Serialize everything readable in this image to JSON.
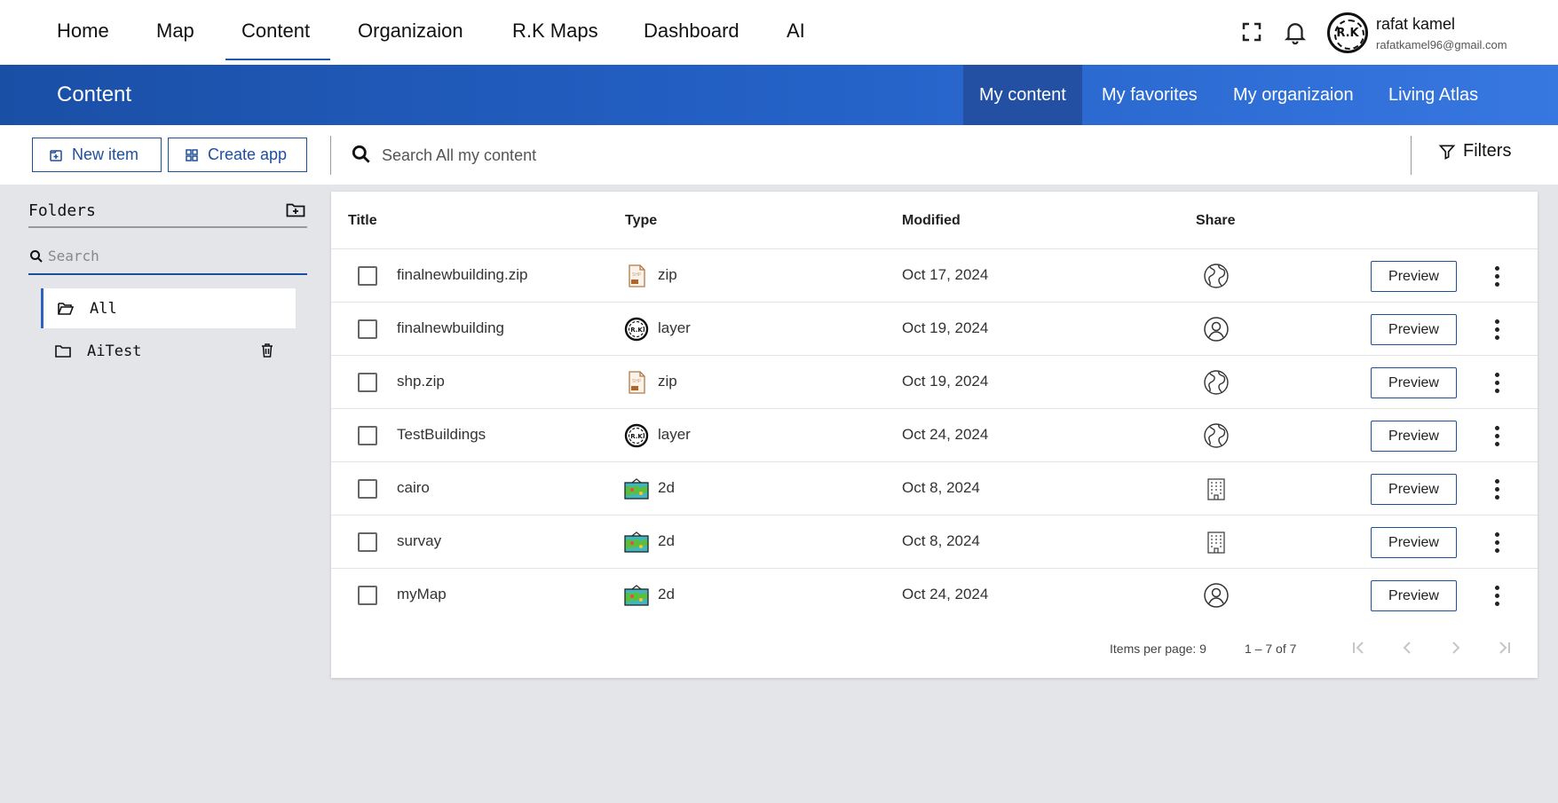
{
  "nav": {
    "items": [
      "Home",
      "Map",
      "Content",
      "Organizaion",
      "R.K Maps",
      "Dashboard",
      "AI"
    ],
    "active": "Content"
  },
  "user": {
    "name": "rafat kamel",
    "email": "rafatkamel96@gmail.com",
    "avatar_text": "R.K"
  },
  "header": {
    "title": "Content",
    "tabs": [
      "My content",
      "My favorites",
      "My organizaion",
      "Living Atlas"
    ],
    "active_tab": "My content"
  },
  "toolbar": {
    "new_item": "New item",
    "create_app": "Create app",
    "search_placeholder": "Search All my content",
    "filters": "Filters"
  },
  "sidebar": {
    "title": "Folders",
    "search_placeholder": "Search",
    "folders": [
      "All",
      "AiTest"
    ],
    "active_folder": "All"
  },
  "table": {
    "headers": [
      "Title",
      "Type",
      "Modified",
      "Share"
    ],
    "preview_label": "Preview",
    "rows": [
      {
        "title": "finalnewbuilding.zip",
        "type": "zip",
        "type_icon": "zip-file-icon",
        "modified": "Oct 17, 2024",
        "share": "public",
        "share_icon": "globe-icon"
      },
      {
        "title": "finalnewbuilding",
        "type": "layer",
        "type_icon": "layer-logo-icon",
        "modified": "Oct 19, 2024",
        "share": "private",
        "share_icon": "person-icon"
      },
      {
        "title": "shp.zip",
        "type": "zip",
        "type_icon": "zip-file-icon",
        "modified": "Oct 19, 2024",
        "share": "public",
        "share_icon": "globe-icon"
      },
      {
        "title": "TestBuildings",
        "type": "layer",
        "type_icon": "layer-logo-icon",
        "modified": "Oct 24, 2024",
        "share": "public",
        "share_icon": "globe-icon"
      },
      {
        "title": "cairo",
        "type": "2d",
        "type_icon": "map-2d-icon",
        "modified": "Oct 8, 2024",
        "share": "organization",
        "share_icon": "building-icon"
      },
      {
        "title": "survay",
        "type": "2d",
        "type_icon": "map-2d-icon",
        "modified": "Oct 8, 2024",
        "share": "organization",
        "share_icon": "building-icon"
      },
      {
        "title": "myMap",
        "type": "2d",
        "type_icon": "map-2d-icon",
        "modified": "Oct 24, 2024",
        "share": "private",
        "share_icon": "person-icon"
      }
    ]
  },
  "pagination": {
    "items_per_page": "Items per page: 9",
    "range": "1 – 7 of 7"
  },
  "colors": {
    "accent": "#1d4f9c",
    "band_start": "#1a4fa6",
    "band_end": "#3777e0",
    "active_tab": "#2450a3",
    "page_bg": "#e4e5e9"
  }
}
